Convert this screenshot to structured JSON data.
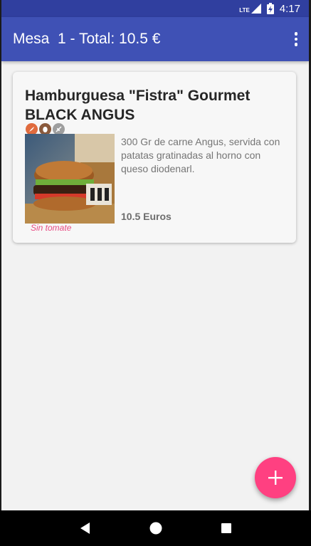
{
  "status_bar": {
    "network_label": "LTE",
    "time": "4:17",
    "icons": [
      "signal-icon",
      "battery-charging-icon"
    ]
  },
  "app_bar": {
    "title": "Mesa  1 - Total: 10.5 €",
    "menu_icon": "more-vert-icon"
  },
  "order_item": {
    "title": "Hamburguesa \"Fistra\" Gourmet BLACK ANGUS",
    "allergen_icons": [
      "allergen-fish-icon",
      "allergen-egg-icon",
      "allergen-celery-icon"
    ],
    "description": "300 Gr de carne Angus, servida con patatas gratinadas al horno con queso diodenarl.",
    "price": "10.5 Euros",
    "note": "Sin tomate"
  },
  "fab": {
    "icon": "plus-icon"
  },
  "nav_bar": {
    "icons": [
      "back-icon",
      "home-icon",
      "recents-icon"
    ]
  },
  "colors": {
    "status_bar": "#303f9f",
    "primary": "#3f51b5",
    "accent": "#ff4081",
    "note": "#e84c84"
  }
}
